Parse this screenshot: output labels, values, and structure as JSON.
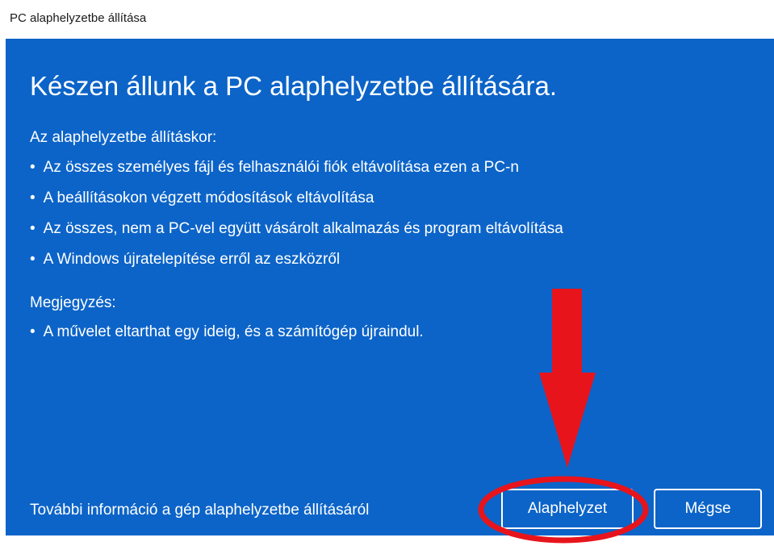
{
  "window": {
    "title": "PC alaphelyzetbe állítása"
  },
  "panel": {
    "heading": "Készen állunk a PC alaphelyzetbe állítására.",
    "reset_section_label": "Az alaphelyzetbe állításkor:",
    "reset_items": [
      "Az összes személyes fájl és felhasználói fiók eltávolítása ezen a PC-n",
      "A beállításokon végzett módosítások eltávolítása",
      "Az összes, nem a PC-vel együtt vásárolt alkalmazás és program eltávolítása",
      "A Windows újratelepítése erről az eszközről"
    ],
    "note_label": "Megjegyzés:",
    "note_items": [
      "A művelet eltarthat egy ideig, és a számítógép újraindul."
    ],
    "bullet_char": "•",
    "info_link": "További információ a gép alaphelyzetbe állításáról"
  },
  "buttons": {
    "reset_label": "Alaphelyzet",
    "cancel_label": "Mégse"
  },
  "annotation": {
    "arrow_color": "#e8141c",
    "circle_color": "#e8141c",
    "icon": "red-arrow-down-icon"
  },
  "colors": {
    "panel_bg": "#0c64c8",
    "text": "#ffffff",
    "titlebar_bg": "#ffffff"
  }
}
